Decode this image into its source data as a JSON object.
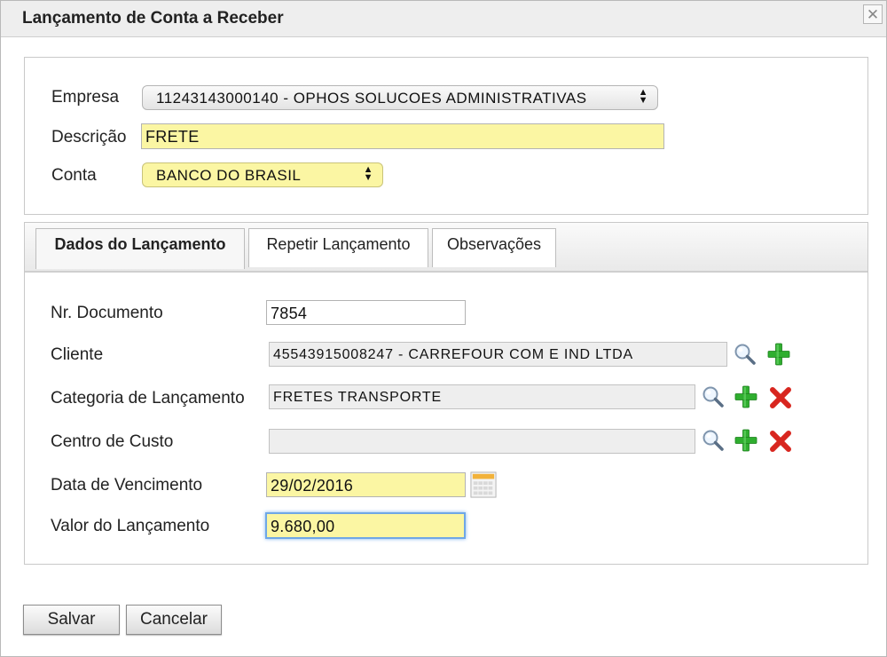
{
  "window": {
    "title": "Lançamento de Conta a Receber",
    "close_symbol": "✕"
  },
  "header_form": {
    "empresa": {
      "label": "Empresa",
      "value": "11243143000140 - OPHOS SOLUCOES ADMINISTRATIVAS"
    },
    "descricao": {
      "label": "Descrição",
      "value": "FRETE"
    },
    "conta": {
      "label": "Conta",
      "value": "BANCO DO BRASIL"
    }
  },
  "tabs": [
    {
      "label": "Dados do Lançamento",
      "active": true
    },
    {
      "label": "Repetir Lançamento",
      "active": false
    },
    {
      "label": "Observações",
      "active": false
    }
  ],
  "details": {
    "nr_documento": {
      "label": "Nr. Documento",
      "value": "7854"
    },
    "cliente": {
      "label": "Cliente",
      "value": "45543915008247 - CARREFOUR COM E IND LTDA"
    },
    "categoria": {
      "label": "Categoria de Lançamento",
      "value": "FRETES TRANSPORTE"
    },
    "centro_custo": {
      "label": "Centro de Custo",
      "value": ""
    },
    "data_vencimento": {
      "label": "Data de Vencimento",
      "value": "29/02/2016"
    },
    "valor": {
      "label": "Valor do Lançamento",
      "value": "9.680,00"
    }
  },
  "buttons": {
    "save": "Salvar",
    "cancel": "Cancelar"
  },
  "icons": {
    "search": "search-icon",
    "add": "add-icon",
    "remove": "remove-icon",
    "calendar": "calendar-icon"
  },
  "colors": {
    "required_field": "#fbf6a3",
    "readonly_field": "#eeeeee",
    "add_green": "#2fae2f",
    "remove_red": "#d8261f",
    "focus_blue": "#6fa7e6"
  }
}
